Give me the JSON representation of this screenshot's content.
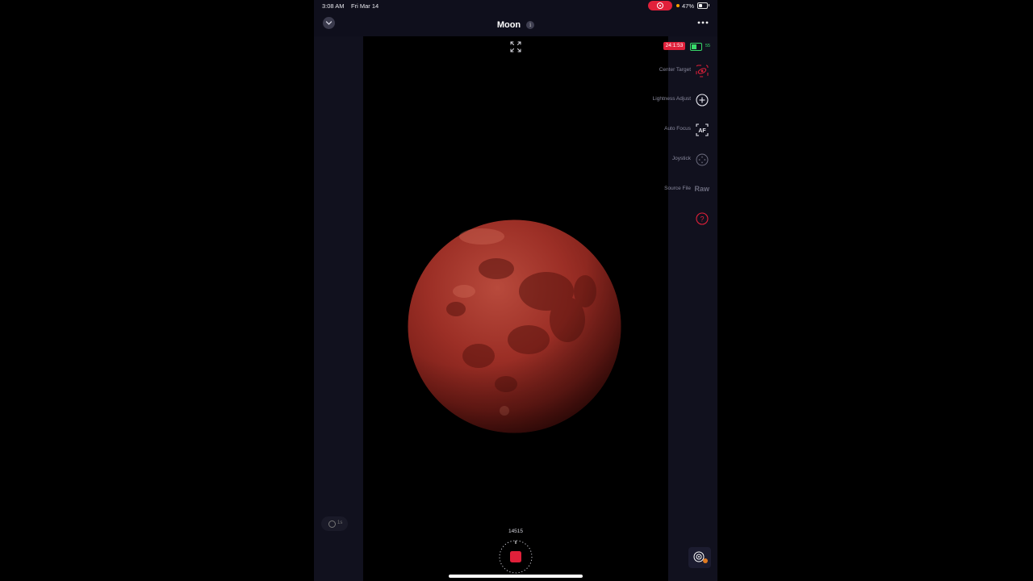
{
  "status_bar": {
    "time": "3:08 AM",
    "date": "Fri Mar 14",
    "battery_percent": "47%",
    "battery_level": 0.47,
    "recording_color": "#e0203a"
  },
  "header": {
    "title": "Moon",
    "info_icon": "info-icon",
    "collapse_icon": "chevron-down-icon",
    "more_icon": "ellipsis-icon"
  },
  "viewport": {
    "expand_icon": "fullscreen-expand-icon",
    "subject": "lunar-eclipse-moon"
  },
  "badges": {
    "timer": "24:1:53",
    "telescope_battery": "55",
    "timer_color": "#e0203a",
    "battery_color": "#38d96a"
  },
  "controls": [
    {
      "label": "Center Target",
      "icon": "center-target-icon"
    },
    {
      "label": "Lightness Adjust",
      "icon": "plus-circle-icon"
    },
    {
      "label": "Auto Focus",
      "icon": "autofocus-icon"
    },
    {
      "label": "Joystick",
      "icon": "joystick-icon"
    },
    {
      "label": "Source File",
      "value": "Raw"
    }
  ],
  "help": {
    "icon": "help-icon"
  },
  "exposure": {
    "value": "1s",
    "icon": "timer-icon"
  },
  "capture": {
    "frame_count": "14515",
    "shutter_icon": "stop-recording-icon",
    "accent": "#e0203a"
  },
  "gallery": {
    "icon": "gallery-thumbnail-icon"
  }
}
